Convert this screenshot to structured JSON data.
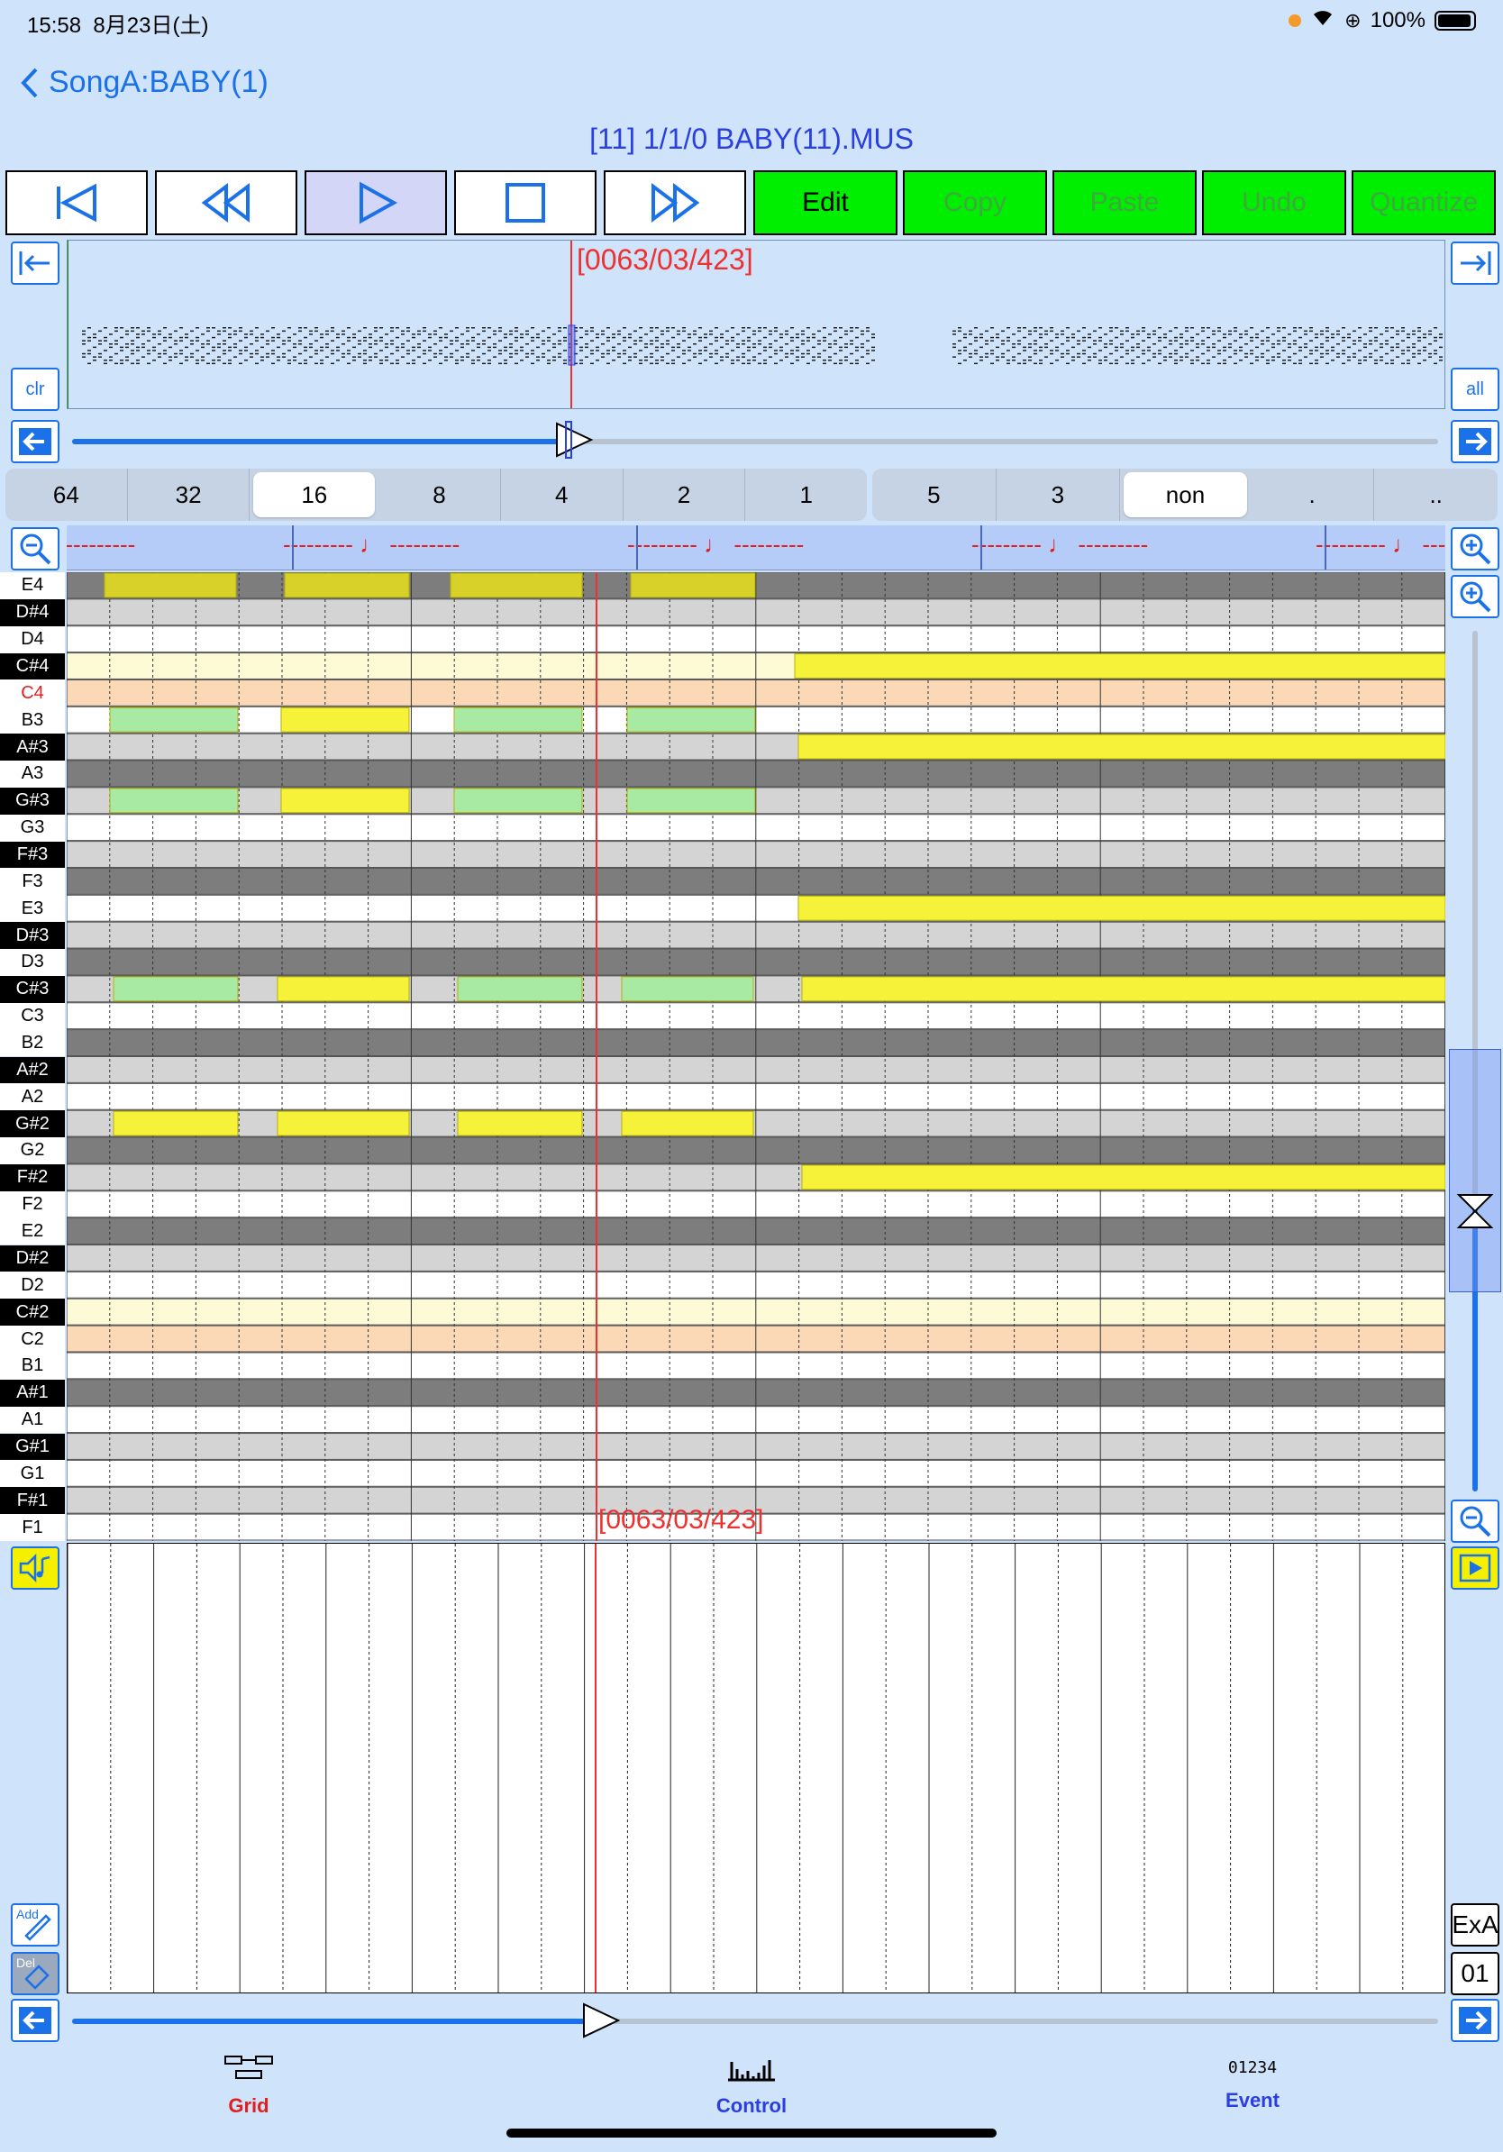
{
  "status": {
    "time": "15:58",
    "date": "8月23日(土)",
    "battery": "100%"
  },
  "nav": {
    "back_label": "SongA:BABY(1)"
  },
  "file_title": "[11] 1/1/0 BABY(11).MUS",
  "edit_buttons": [
    {
      "label": "Edit",
      "active": true
    },
    {
      "label": "Copy",
      "active": false
    },
    {
      "label": "Paste",
      "active": false
    },
    {
      "label": "Undo",
      "active": false
    },
    {
      "label": "Quantize",
      "active": false
    }
  ],
  "position_readout": "[0063/03/423]",
  "quantize_options": [
    "64",
    "32",
    "16",
    "8",
    "4",
    "2",
    "1"
  ],
  "quantize_selected": "16",
  "tuplet_options": [
    "5",
    "3",
    "non",
    ".",
    ".."
  ],
  "tuplet_selected": "non",
  "ruler_label": "--------- ♩ ---------",
  "keys": [
    "E4",
    "D#4",
    "D4",
    "C#4",
    "C4",
    "B3",
    "A#3",
    "A3",
    "G#3",
    "G3",
    "F#3",
    "F3",
    "E3",
    "D#3",
    "D3",
    "C#3",
    "C3",
    "B2",
    "A#2",
    "A2",
    "G#2",
    "G2",
    "F#2",
    "F2",
    "E2",
    "D#2",
    "D2",
    "C#2",
    "C2",
    "B1",
    "A#1",
    "A1",
    "G#1",
    "G1",
    "F#1",
    "F1"
  ],
  "side": {
    "clr": "clr",
    "all": "all",
    "exa": "ExA",
    "channel": "01",
    "add": "Add",
    "del": "Del"
  },
  "tabs": [
    {
      "label": "Grid",
      "active": true
    },
    {
      "label": "Control",
      "active": false
    },
    {
      "label": "Event",
      "active": false
    }
  ],
  "event_icon_text": "01234"
}
